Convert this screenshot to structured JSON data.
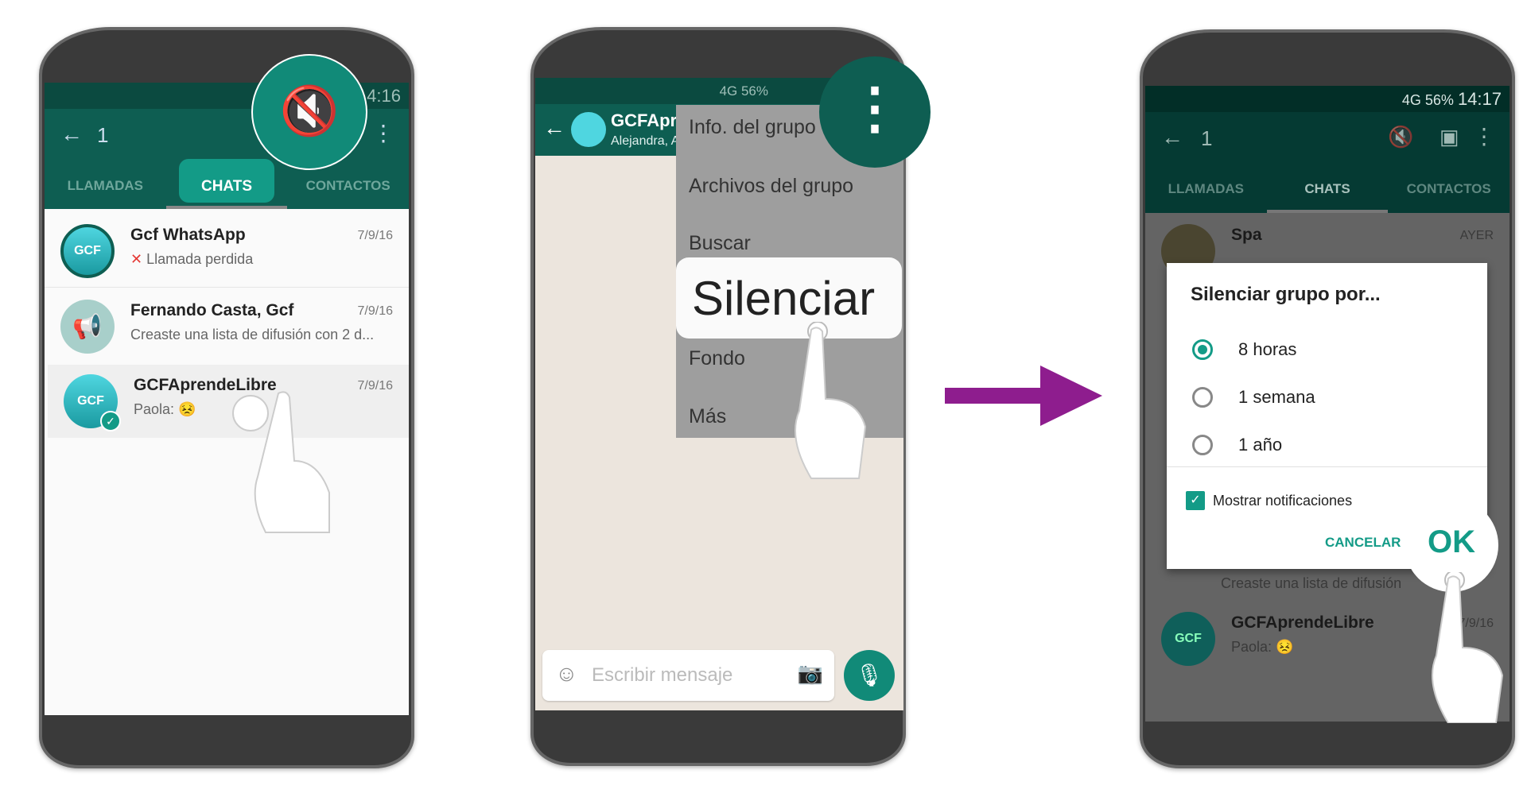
{
  "phone1": {
    "status_time": "14:16",
    "selected_count": "1",
    "tabs": [
      {
        "label": "LLAMADAS"
      },
      {
        "label": "CHATS"
      },
      {
        "label": "CONTACTOS"
      }
    ],
    "avatar_text": "GCF",
    "chats": [
      {
        "name": "Gcf WhatsApp",
        "message": "Llamada perdida",
        "date": "7/9/16"
      },
      {
        "name": "Fernando Casta, Gcf",
        "message": "Creaste una lista de difusión con 2 d...",
        "date": "7/9/16"
      },
      {
        "name": "GCFAprendeLibre",
        "message": "Paola: 😣",
        "date": "7/9/16"
      }
    ]
  },
  "phone2": {
    "status": "4G  56%",
    "chat_title": "GCFApre",
    "chat_subtitle": "Alejandra, A",
    "menu": [
      {
        "label": "Info. del grupo"
      },
      {
        "label": "Archivos del grupo"
      },
      {
        "label": "Buscar"
      },
      {
        "label": "Silenciar"
      },
      {
        "label": "Fondo"
      },
      {
        "label": "Más"
      }
    ],
    "input_placeholder": "Escribir mensaje"
  },
  "phone3": {
    "status": "4G  56%",
    "status_time": "14:17",
    "selected_count": "1",
    "tabs": [
      {
        "label": "LLAMADAS"
      },
      {
        "label": "CHATS"
      },
      {
        "label": "CONTACTOS"
      }
    ],
    "bg_chats": [
      {
        "name": "Spa",
        "date": "AYER"
      },
      {
        "name": "GCFAprendeLibre",
        "message": "Paola: 😣",
        "date": "7/9/16"
      }
    ],
    "bg_partial_text": "Creaste una lista de difusión",
    "dialog": {
      "title": "Silenciar grupo por...",
      "options": [
        {
          "label": "8 horas",
          "selected": true
        },
        {
          "label": "1 semana",
          "selected": false
        },
        {
          "label": "1 año",
          "selected": false
        }
      ],
      "checkbox_label": "Mostrar notificaciones",
      "checkbox_checked": true,
      "cancel": "CANCELAR",
      "ok": "OK"
    }
  },
  "colors": {
    "teal_dark": "#0e5e52",
    "teal_accent": "#139b87",
    "arrow": "#8e1d8e"
  }
}
